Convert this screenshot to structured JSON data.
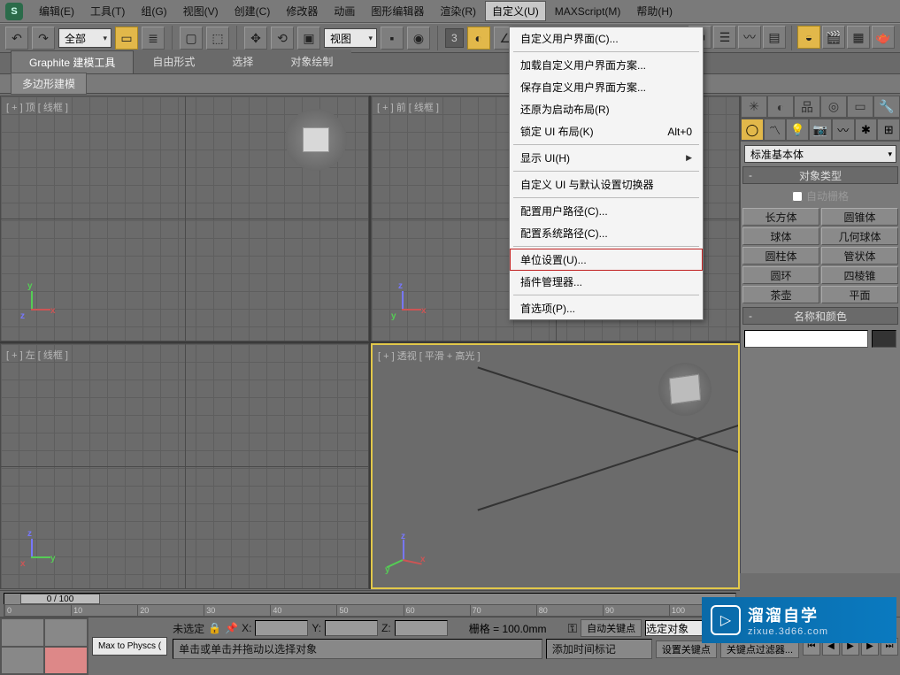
{
  "menubar": {
    "items": [
      "编辑(E)",
      "工具(T)",
      "组(G)",
      "视图(V)",
      "创建(C)",
      "修改器",
      "动画",
      "图形编辑器",
      "渲染(R)",
      "自定义(U)",
      "MAXScript(M)",
      "帮助(H)"
    ],
    "active_index": 9
  },
  "toolbar": {
    "filter": "全部",
    "viewsel": "视图",
    "coord_num": "3"
  },
  "ribbon": {
    "tabs": [
      "Graphite 建模工具",
      "自由形式",
      "选择",
      "对象绘制"
    ],
    "active_index": 0,
    "subtab": "多边形建模"
  },
  "dropdown": {
    "items": [
      {
        "label": "自定义用户界面(C)..."
      },
      {
        "sep": true
      },
      {
        "label": "加载自定义用户界面方案..."
      },
      {
        "label": "保存自定义用户界面方案..."
      },
      {
        "label": "还原为启动布局(R)"
      },
      {
        "label": "锁定 UI 布局(K)",
        "accel": "Alt+0"
      },
      {
        "sep": true
      },
      {
        "label": "显示 UI(H)",
        "sub": true
      },
      {
        "sep": true
      },
      {
        "label": "自定义 UI 与默认设置切换器"
      },
      {
        "sep": true
      },
      {
        "label": "配置用户路径(C)..."
      },
      {
        "label": "配置系统路径(C)..."
      },
      {
        "sep": true
      },
      {
        "label": "单位设置(U)...",
        "hl": true
      },
      {
        "label": "插件管理器..."
      },
      {
        "sep": true
      },
      {
        "label": "首选项(P)..."
      }
    ]
  },
  "viewports": {
    "tl": "[ + ] 顶 [ 线框 ]",
    "tr": "[ + ] 前 [ 线框 ]",
    "bl": "[ + ] 左 [ 线框 ]",
    "br": "[ + ] 透视 [ 平滑 + 高光 ]"
  },
  "panel": {
    "category": "标准基本体",
    "rollout1": "对象类型",
    "autogrid": "自动栅格",
    "buttons": [
      "长方体",
      "圆锥体",
      "球体",
      "几何球体",
      "圆柱体",
      "管状体",
      "圆环",
      "四棱锥",
      "茶壶",
      "平面"
    ],
    "rollout2": "名称和颜色"
  },
  "timeline": {
    "thumb": "0 / 100",
    "ticks": [
      "0",
      "10",
      "20",
      "30",
      "40",
      "50",
      "60",
      "70",
      "80",
      "90",
      "100"
    ]
  },
  "status": {
    "script": "Max to Physcs (",
    "unselected": "未选定",
    "x": "X:",
    "y": "Y:",
    "z": "Z:",
    "grid_label": "栅格 = 100.0mm",
    "hint": "单击或单击并拖动以选择对象",
    "addmark": "添加时间标记",
    "autokey": "自动关键点",
    "setkey": "设置关键点",
    "selobj": "选定对象",
    "keyfilter": "关键点过滤器..."
  },
  "watermark": {
    "title": "溜溜自学",
    "url": "zixue.3d66.com"
  }
}
